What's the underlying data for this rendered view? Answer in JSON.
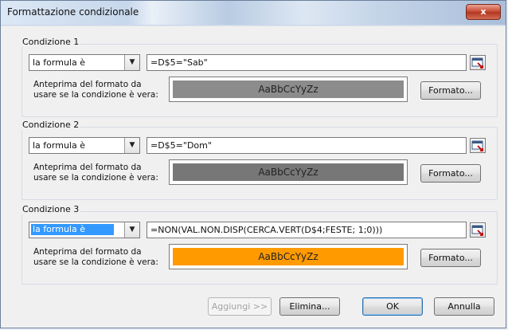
{
  "window": {
    "title": "Formattazione condizionale",
    "close_label": "x"
  },
  "conditions": [
    {
      "label": "Condizione 1",
      "type_value": "la formula è",
      "formula": "=D$5=\"Sab\"",
      "preview_label": "Anteprima del formato da usare se la condizione è vera:",
      "preview_text": "AaBbCcYyZz",
      "preview_color": "#8c8c8c",
      "format_button": "Formato..."
    },
    {
      "label": "Condizione 2",
      "type_value": "la formula è",
      "formula": "=D$5=\"Dom\"",
      "preview_label": "Anteprima del formato da usare se la condizione è vera:",
      "preview_text": "AaBbCcYyZz",
      "preview_color": "#777777",
      "format_button": "Formato..."
    },
    {
      "label": "Condizione 3",
      "type_value": "la formula è",
      "formula": "=NON(VAL.NON.DISP(CERCA.VERT(D$4;FESTE; 1;0)))",
      "preview_label": "Anteprima del formato da usare se la condizione è vera:",
      "preview_text": "AaBbCcYyZz",
      "preview_color": "#ff9a00",
      "format_button": "Formato..."
    }
  ],
  "footer": {
    "add_button": "Aggiungi >>",
    "delete_button": "Elimina...",
    "ok_button": "OK",
    "cancel_button": "Annulla"
  }
}
